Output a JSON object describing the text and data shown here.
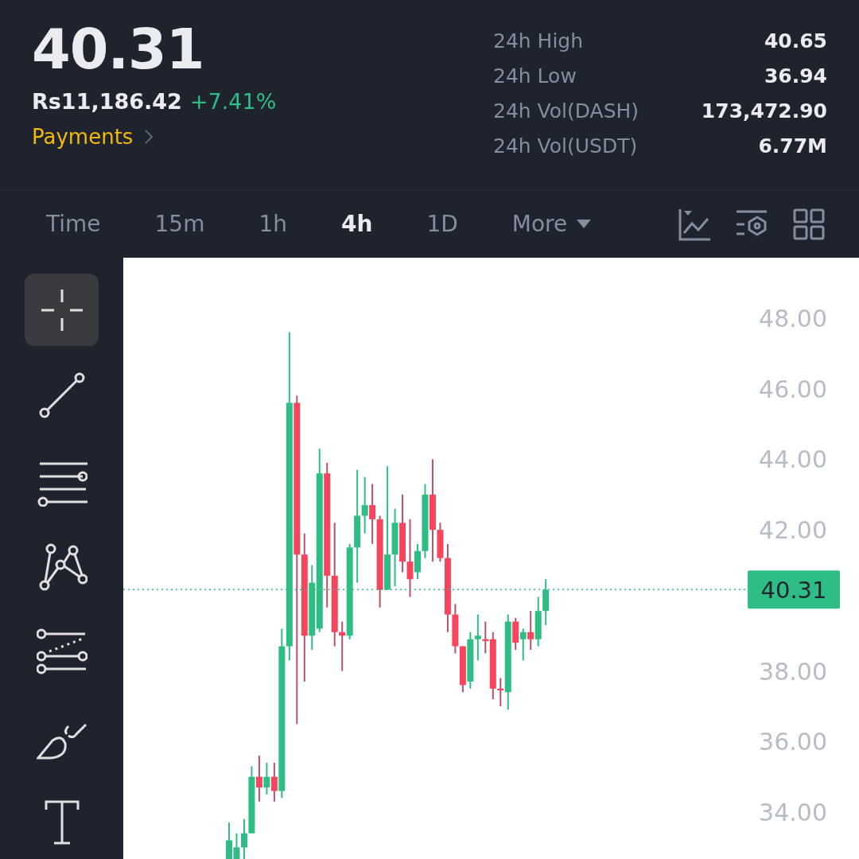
{
  "ticker": {
    "price": "40.31",
    "fiat_price": "Rs11,186.42",
    "change": "+7.41%",
    "tag": "Payments"
  },
  "stats": [
    {
      "label": "24h High",
      "value": "40.65"
    },
    {
      "label": "24h Low",
      "value": "36.94"
    },
    {
      "label": "24h Vol(DASH)",
      "value": "173,472.90"
    },
    {
      "label": "24h Vol(USDT)",
      "value": "6.77M"
    }
  ],
  "intervals": [
    {
      "label": "Time",
      "selected": false
    },
    {
      "label": "15m",
      "selected": false
    },
    {
      "label": "1h",
      "selected": false
    },
    {
      "label": "4h",
      "selected": true
    },
    {
      "label": "1D",
      "selected": false
    }
  ],
  "more": {
    "label": "More"
  },
  "chart_tools": [
    {
      "kind": "line-chart"
    },
    {
      "kind": "indicators"
    },
    {
      "kind": "grid"
    }
  ],
  "drawing_tools": [
    {
      "kind": "crosshair",
      "selected": true
    },
    {
      "kind": "trend-line",
      "selected": false
    },
    {
      "kind": "parallel-lines",
      "selected": false
    },
    {
      "kind": "pattern",
      "selected": false
    },
    {
      "kind": "fib",
      "selected": false
    },
    {
      "kind": "brush",
      "selected": false
    },
    {
      "kind": "text",
      "selected": false
    }
  ],
  "chart": {
    "y_axis_labels": [
      "48.00",
      "46.00",
      "44.00",
      "42.00",
      "38.00",
      "36.00",
      "34.00"
    ],
    "last_price": "40.31"
  }
}
